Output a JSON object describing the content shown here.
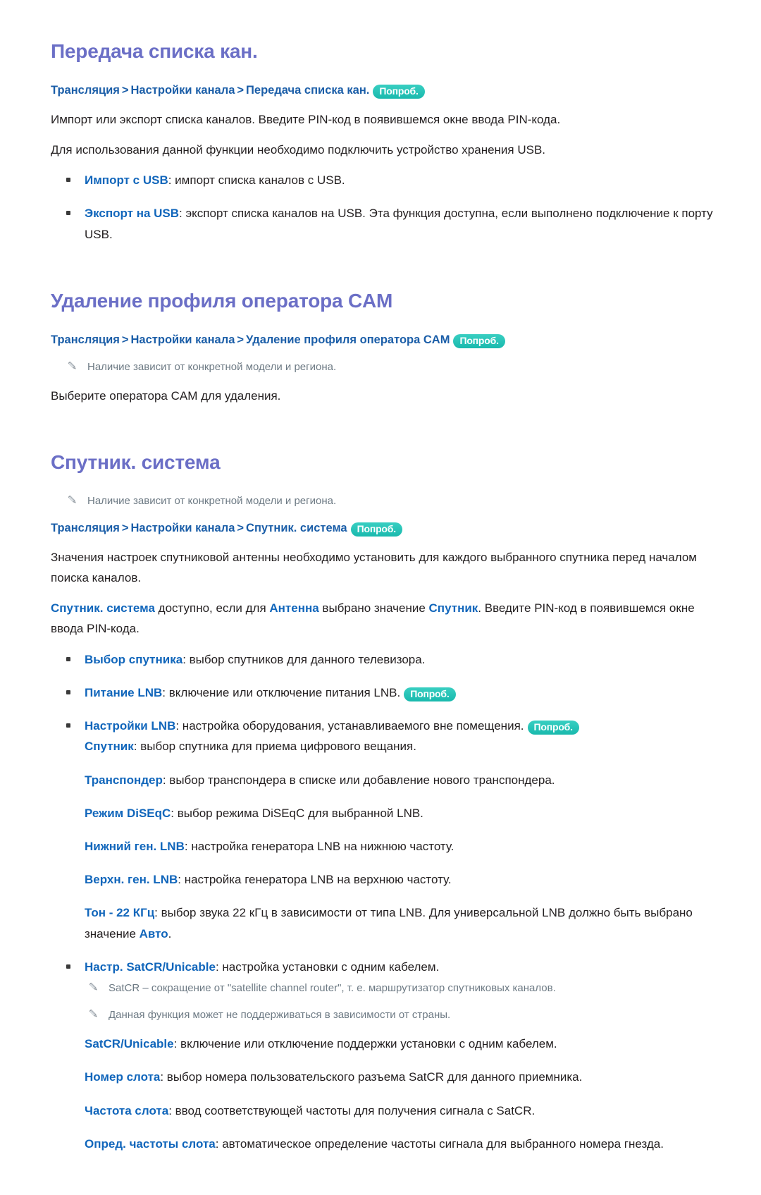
{
  "document": {
    "language": "ru",
    "colors": {
      "heading": "#6b6fc6",
      "breadcrumb": "#1b5ea8",
      "term": "#1166bb",
      "badge_bg": "#23bfb3",
      "note_text": "#6d7a84",
      "body_text": "#231f20",
      "page_bg": "#ffffff"
    }
  },
  "common": {
    "badge_label": "Попроб.",
    "breadcrumb_separator": ">",
    "crumb_broadcast": "Трансляция",
    "crumb_channel_settings": "Настройки канала",
    "note_model_region": "Наличие зависит от конкретной модели и региона.",
    "pencil_icon": "pencil-icon"
  },
  "sections": [
    {
      "id": "transfer-channel-list",
      "title": "Передача списка кан.",
      "breadcrumb_last": "Передача списка кан.",
      "paragraphs": [
        "Импорт или экспорт списка каналов. Введите PIN-код в появившемся окне ввода PIN-кода.",
        "Для использования данной функции необходимо подключить устройство хранения USB."
      ],
      "bullets": [
        {
          "term": "Импорт с USB",
          "text": ": импорт списка каналов с USB."
        },
        {
          "term": "Экспорт на USB",
          "text": ": экспорт списка каналов на USB. Эта функция доступна, если выполнено подключение к порту USB."
        }
      ]
    },
    {
      "id": "delete-cam-operator-profile",
      "title": "Удаление профиля оператора CAM",
      "breadcrumb_last": "Удаление профиля оператора CAM",
      "note": "Наличие зависит от конкретной модели и региона.",
      "paragraphs": [
        "Выберите оператора CAM для удаления."
      ]
    },
    {
      "id": "satellite-system",
      "title": "Спутник. система",
      "note_before": "Наличие зависит от конкретной модели и региона.",
      "breadcrumb_last": "Спутник. система",
      "paragraph_1": "Значения настроек спутниковой антенны необходимо установить для каждого выбранного спутника перед началом поиска каналов.",
      "paragraph_2": {
        "term_1": "Спутник. система",
        "mid_1": " доступно, если для ",
        "term_2": "Антенна",
        "mid_2": " выбрано значение ",
        "term_3": "Спутник",
        "tail": ". Введите PIN-код в появившемся окне ввода PIN-кода."
      },
      "items": [
        {
          "kind": "bullet",
          "term": "Выбор спутника",
          "text": ": выбор спутников для данного телевизора.",
          "badge": false
        },
        {
          "kind": "bullet",
          "term": "Питание LNB",
          "text": ": включение или отключение питания LNB.",
          "badge": true
        },
        {
          "kind": "bullet",
          "term": "Настройки LNB",
          "text": ": настройка оборудования, устанавливаемого вне помещения.",
          "badge": true
        },
        {
          "kind": "sub",
          "term": "Спутник",
          "text": ": выбор спутника для приема цифрового вещания.",
          "badge": false
        },
        {
          "kind": "sub",
          "term": "Транспондер",
          "text": ": выбор транспондера в списке или добавление нового транспондера.",
          "badge": false
        },
        {
          "kind": "sub",
          "term": "Режим DiSEqC",
          "text": ": выбор режима DiSEqC для выбранной LNB.",
          "badge": false
        },
        {
          "kind": "sub",
          "term": "Нижний ген. LNB",
          "text": ": настройка генератора LNB на нижнюю частоту.",
          "badge": false
        },
        {
          "kind": "sub",
          "term": "Верхн. ген. LNB",
          "text": ": настройка генератора LNB на верхнюю частоту.",
          "badge": false
        }
      ],
      "tone_item": {
        "kind": "sub",
        "term": "Тон - 22 КГц",
        "text_before": ": выбор звука 22 кГц в зависимости от типа LNB. Для универсальной LNB должно быть выбрано значение ",
        "term_end": "Авто",
        "text_after": "."
      },
      "satcr_bullet": {
        "kind": "bullet",
        "term": "Настр. SatCR/Unicable",
        "text": ": настройка установки с одним кабелем."
      },
      "satcr_notes": [
        "SatCR – сокращение от \"satellite channel router\", т. е. маршрутизатор спутниковых каналов.",
        "Данная функция может не поддерживаться в зависимости от страны."
      ],
      "satcr_items": [
        {
          "kind": "sub",
          "term": "SatCR/Unicable",
          "text": ": включение или отключение поддержки установки с одним кабелем."
        },
        {
          "kind": "sub",
          "term": "Номер слота",
          "text": ": выбор номера пользовательского разъема SatCR для данного приемника."
        },
        {
          "kind": "sub",
          "term": "Частота слота",
          "text": ": ввод соответствующей частоты для получения сигнала с SatCR."
        },
        {
          "kind": "sub",
          "term": "Опред. частоты слота",
          "text": ": автоматическое определение частоты сигнала для выбранного номера гнезда."
        }
      ]
    }
  ]
}
